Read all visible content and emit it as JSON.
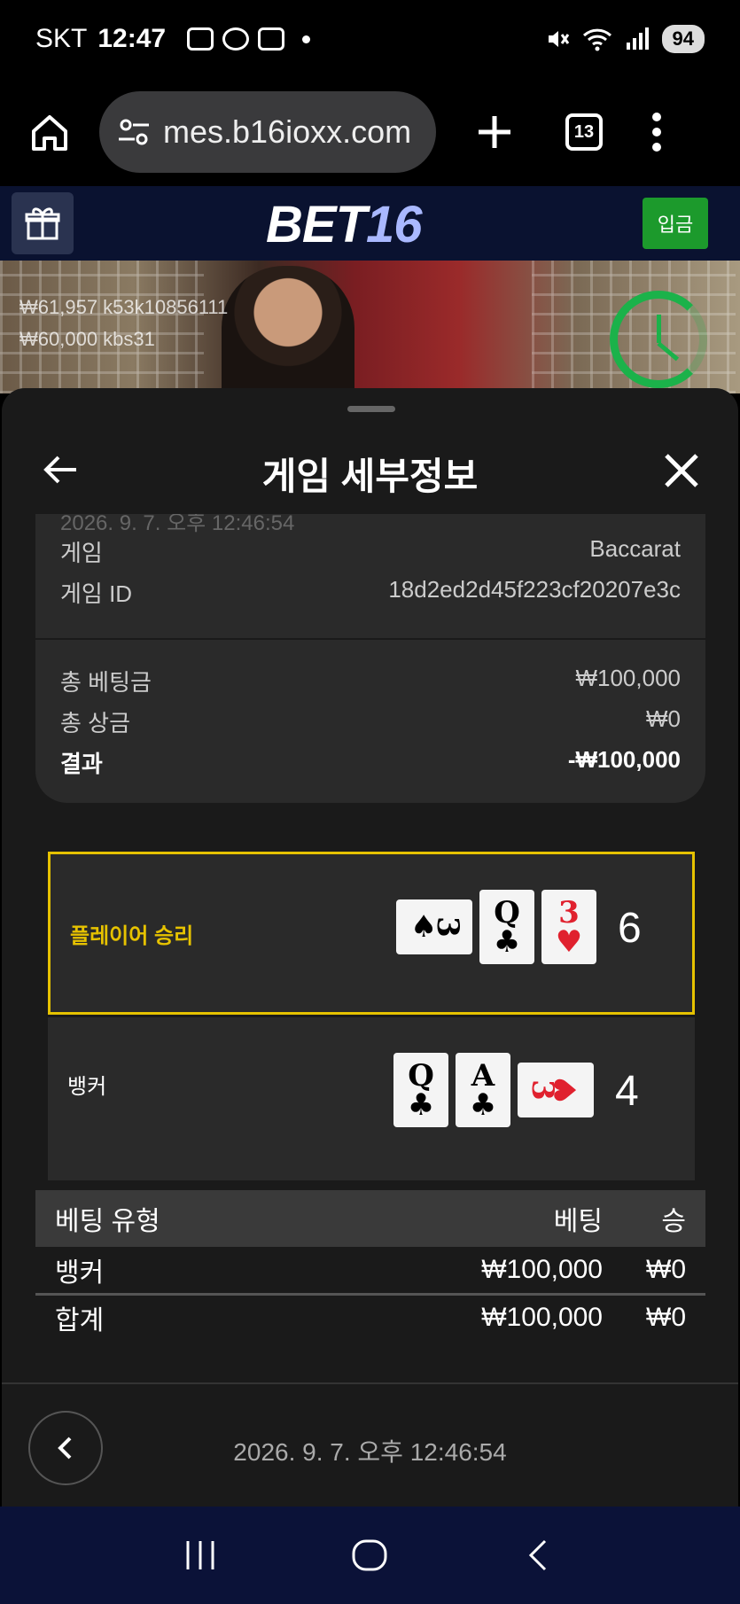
{
  "status_bar": {
    "carrier": "SKT",
    "time": "12:47",
    "battery": "94"
  },
  "browser": {
    "url": "mes.b16ioxx.com",
    "tab_count": "13"
  },
  "site": {
    "logo_part1": "BET",
    "logo_part2": "16",
    "deposit_label": "입금"
  },
  "video": {
    "bet_lines": [
      "₩61,957  k53k10856111",
      "₩60,000  kbs31"
    ]
  },
  "sheet": {
    "title": "게임 세부정보",
    "faded_date": "2026. 9. 7. 오후 12:46:54",
    "info": [
      {
        "label": "게임",
        "value": "Baccarat"
      },
      {
        "label": "게임 ID",
        "value": "18d2ed2d45f223cf20207e3c"
      }
    ],
    "summary": [
      {
        "label": "총 베팅금",
        "value": "₩100,000"
      },
      {
        "label": "총 상금",
        "value": "₩0"
      },
      {
        "label": "결과",
        "value": "-₩100,000"
      }
    ],
    "player": {
      "label": "플레이어 승리",
      "score": "6",
      "cards": [
        {
          "rank": "3",
          "suit": "♠",
          "color": "black",
          "orientation": "h"
        },
        {
          "rank": "Q",
          "suit": "♣",
          "color": "black",
          "orientation": "v"
        },
        {
          "rank": "3",
          "suit": "♥",
          "color": "red",
          "orientation": "v"
        }
      ]
    },
    "banker": {
      "label": "뱅커",
      "score": "4",
      "cards": [
        {
          "rank": "Q",
          "suit": "♣",
          "color": "black",
          "orientation": "v"
        },
        {
          "rank": "A",
          "suit": "♣",
          "color": "black",
          "orientation": "v"
        },
        {
          "rank": "3",
          "suit": "♥",
          "color": "red",
          "orientation": "h"
        }
      ]
    },
    "bet_table": {
      "headers": [
        "베팅 유형",
        "베팅",
        "승"
      ],
      "rows": [
        [
          "뱅커",
          "₩100,000",
          "₩0"
        ]
      ],
      "total": [
        "합계",
        "₩100,000",
        "₩0"
      ]
    },
    "footer_date": "2026. 9. 7. 오후 12:46:54"
  },
  "colors": {
    "winner_accent": "#e6c200",
    "deposit_green": "#1c9a2c",
    "header_navy": "#0a1230"
  }
}
